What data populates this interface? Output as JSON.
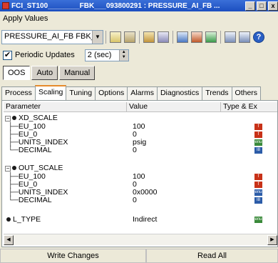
{
  "window": {
    "title": "FCI_ST100________FBK___093800291 : PRESSURE_AI_FB ...",
    "min_glyph": "_",
    "max_glyph": "□",
    "close_glyph": "x"
  },
  "menu": {
    "items": [
      "Apply Values"
    ]
  },
  "toolbar": {
    "block_select": "PRESSURE_AI_FB   FBK__"
  },
  "periodic": {
    "label": "Periodic Updates",
    "checked_glyph": "✔",
    "interval": "2 (sec)"
  },
  "modes": [
    "OOS",
    "Auto",
    "Manual"
  ],
  "tabs": [
    "Process",
    "Scaling",
    "Tuning",
    "Options",
    "Alarms",
    "Diagnostics",
    "Trends",
    "Others"
  ],
  "active_tab": "Scaling",
  "grid": {
    "columns": [
      "Parameter",
      "Value",
      "Type & Ex"
    ],
    "groups": [
      {
        "name": "XD_SCALE",
        "expand_glyph": "−",
        "rows": [
          {
            "branch": "├─",
            "name": "EU_100",
            "value": "100",
            "type_icon": "float-icon",
            "type_glyph": "f"
          },
          {
            "branch": "├─",
            "name": "EU_0",
            "value": "0",
            "type_icon": "float-icon",
            "type_glyph": "f"
          },
          {
            "branch": "├─",
            "name": "UNITS_INDEX",
            "value": "psig",
            "type_icon": "enum-icon",
            "type_glyph": "enu"
          },
          {
            "branch": "└─",
            "name": "DECIMAL",
            "value": "0",
            "type_icon": "int-icon",
            "type_glyph": "I8"
          }
        ]
      },
      {
        "name": "OUT_SCALE",
        "expand_glyph": "−",
        "rows": [
          {
            "branch": "├─",
            "name": "EU_100",
            "value": "100",
            "type_icon": "float-icon",
            "type_glyph": "f"
          },
          {
            "branch": "├─",
            "name": "EU_0",
            "value": "0",
            "type_icon": "float-icon",
            "type_glyph": "f"
          },
          {
            "branch": "├─",
            "name": "UNITS_INDEX",
            "value": "0x0000",
            "type_icon": "enum-icon",
            "type_glyph": "enu"
          },
          {
            "branch": "└─",
            "name": "DECIMAL",
            "value": "0",
            "type_icon": "int-icon",
            "type_glyph": "I8"
          }
        ]
      }
    ],
    "single": {
      "name": "L_TYPE",
      "value": "Indirect",
      "type_icon": "enum-icon",
      "type_glyph": "enu"
    }
  },
  "footer": {
    "write_label": "Write Changes",
    "read_label": "Read All"
  }
}
